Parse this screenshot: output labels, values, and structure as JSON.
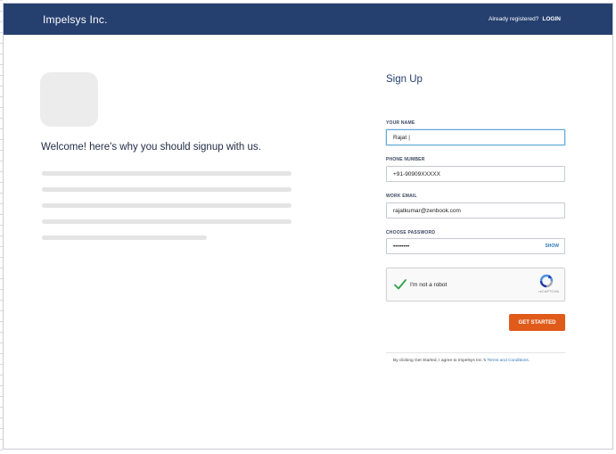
{
  "header": {
    "brand": "Impelsys Inc.",
    "already_registered": "Already registered?",
    "login_label": "LOGIN"
  },
  "intro": {
    "welcome_text": "Welcome! here's why you should signup with us."
  },
  "form": {
    "title": "Sign Up",
    "fields": {
      "name": {
        "label": "YOUR NAME",
        "value": "Rajat"
      },
      "phone": {
        "label": "PHONE NUMBER",
        "value": "+91-90909XXXXX"
      },
      "email": {
        "label": "WORK EMAIL",
        "value": "rajatkumar@zenbook.com"
      },
      "password": {
        "label": "CHOOSE PASSWORD",
        "value": "••••••••",
        "show_label": "SHOW"
      }
    },
    "captcha": {
      "label": "I'm not a robot",
      "brand": "reCAPTCHA",
      "checked": true
    },
    "submit_label": "GET STARTED",
    "terms_prefix": "By clicking Get Started, I agree to Impelsys Inc.'s",
    "terms_link": "Terms and Conditions."
  },
  "colors": {
    "header_bg": "#253f6f",
    "button_bg": "#e05a1a",
    "link": "#2f79b7",
    "check": "#30a04a"
  }
}
